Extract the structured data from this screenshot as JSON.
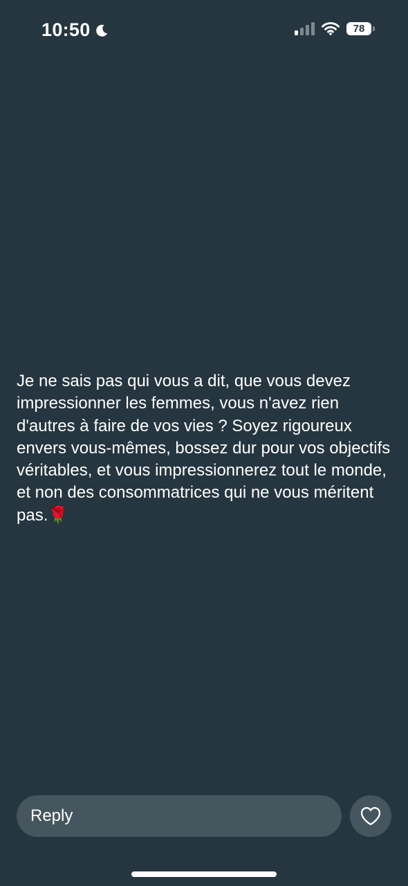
{
  "status_bar": {
    "time": "10:50",
    "battery_level": "78",
    "signal_bars_active": 1,
    "signal_bars_total": 4,
    "icons": [
      "moon-icon",
      "signal-icon",
      "wifi-icon",
      "battery-icon"
    ]
  },
  "message": {
    "text": "Je ne sais pas qui vous a dit, que vous devez impressionner les femmes, vous n'avez rien d'autres à faire de vos vies ? Soyez rigoureux envers vous-mêmes, bossez dur pour vos objectifs véritables, et vous impressionnerez tout le monde, et non des consommatrices qui ne vous méritent pas.🌹"
  },
  "reply_bar": {
    "placeholder": "Reply",
    "like_icon": "heart-icon"
  },
  "colors": {
    "background": "#263640",
    "input_background": "#45565e",
    "text": "#ffffff"
  }
}
